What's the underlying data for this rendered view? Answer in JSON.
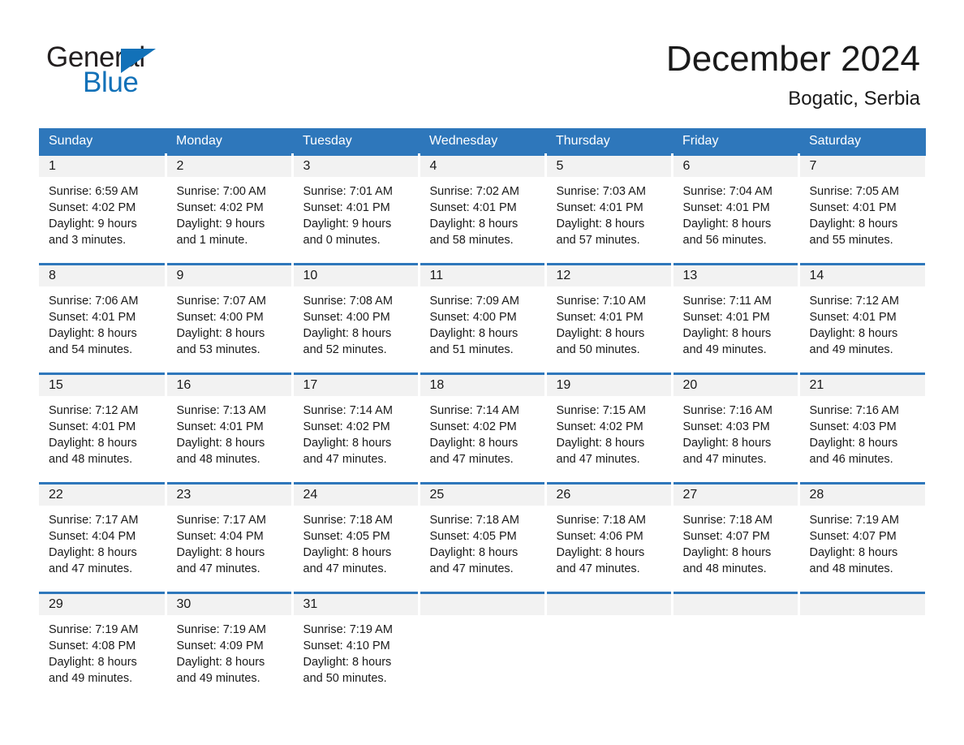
{
  "brand": {
    "word_one": "General",
    "word_two": "Blue",
    "triangle_color": "#1271b8"
  },
  "header": {
    "month_title": "December 2024",
    "location": "Bogatic, Serbia"
  },
  "theme": {
    "header_blue": "#2e77bb",
    "daynum_gray": "#f2f2f2",
    "text": "#1a1a1a"
  },
  "day_headers": [
    "Sunday",
    "Monday",
    "Tuesday",
    "Wednesday",
    "Thursday",
    "Friday",
    "Saturday"
  ],
  "weeks": [
    [
      {
        "day": "1",
        "sunrise": "Sunrise: 6:59 AM",
        "sunset": "Sunset: 4:02 PM",
        "daylight_line1": "Daylight: 9 hours",
        "daylight_line2": "and 3 minutes."
      },
      {
        "day": "2",
        "sunrise": "Sunrise: 7:00 AM",
        "sunset": "Sunset: 4:02 PM",
        "daylight_line1": "Daylight: 9 hours",
        "daylight_line2": "and 1 minute."
      },
      {
        "day": "3",
        "sunrise": "Sunrise: 7:01 AM",
        "sunset": "Sunset: 4:01 PM",
        "daylight_line1": "Daylight: 9 hours",
        "daylight_line2": "and 0 minutes."
      },
      {
        "day": "4",
        "sunrise": "Sunrise: 7:02 AM",
        "sunset": "Sunset: 4:01 PM",
        "daylight_line1": "Daylight: 8 hours",
        "daylight_line2": "and 58 minutes."
      },
      {
        "day": "5",
        "sunrise": "Sunrise: 7:03 AM",
        "sunset": "Sunset: 4:01 PM",
        "daylight_line1": "Daylight: 8 hours",
        "daylight_line2": "and 57 minutes."
      },
      {
        "day": "6",
        "sunrise": "Sunrise: 7:04 AM",
        "sunset": "Sunset: 4:01 PM",
        "daylight_line1": "Daylight: 8 hours",
        "daylight_line2": "and 56 minutes."
      },
      {
        "day": "7",
        "sunrise": "Sunrise: 7:05 AM",
        "sunset": "Sunset: 4:01 PM",
        "daylight_line1": "Daylight: 8 hours",
        "daylight_line2": "and 55 minutes."
      }
    ],
    [
      {
        "day": "8",
        "sunrise": "Sunrise: 7:06 AM",
        "sunset": "Sunset: 4:01 PM",
        "daylight_line1": "Daylight: 8 hours",
        "daylight_line2": "and 54 minutes."
      },
      {
        "day": "9",
        "sunrise": "Sunrise: 7:07 AM",
        "sunset": "Sunset: 4:00 PM",
        "daylight_line1": "Daylight: 8 hours",
        "daylight_line2": "and 53 minutes."
      },
      {
        "day": "10",
        "sunrise": "Sunrise: 7:08 AM",
        "sunset": "Sunset: 4:00 PM",
        "daylight_line1": "Daylight: 8 hours",
        "daylight_line2": "and 52 minutes."
      },
      {
        "day": "11",
        "sunrise": "Sunrise: 7:09 AM",
        "sunset": "Sunset: 4:00 PM",
        "daylight_line1": "Daylight: 8 hours",
        "daylight_line2": "and 51 minutes."
      },
      {
        "day": "12",
        "sunrise": "Sunrise: 7:10 AM",
        "sunset": "Sunset: 4:01 PM",
        "daylight_line1": "Daylight: 8 hours",
        "daylight_line2": "and 50 minutes."
      },
      {
        "day": "13",
        "sunrise": "Sunrise: 7:11 AM",
        "sunset": "Sunset: 4:01 PM",
        "daylight_line1": "Daylight: 8 hours",
        "daylight_line2": "and 49 minutes."
      },
      {
        "day": "14",
        "sunrise": "Sunrise: 7:12 AM",
        "sunset": "Sunset: 4:01 PM",
        "daylight_line1": "Daylight: 8 hours",
        "daylight_line2": "and 49 minutes."
      }
    ],
    [
      {
        "day": "15",
        "sunrise": "Sunrise: 7:12 AM",
        "sunset": "Sunset: 4:01 PM",
        "daylight_line1": "Daylight: 8 hours",
        "daylight_line2": "and 48 minutes."
      },
      {
        "day": "16",
        "sunrise": "Sunrise: 7:13 AM",
        "sunset": "Sunset: 4:01 PM",
        "daylight_line1": "Daylight: 8 hours",
        "daylight_line2": "and 48 minutes."
      },
      {
        "day": "17",
        "sunrise": "Sunrise: 7:14 AM",
        "sunset": "Sunset: 4:02 PM",
        "daylight_line1": "Daylight: 8 hours",
        "daylight_line2": "and 47 minutes."
      },
      {
        "day": "18",
        "sunrise": "Sunrise: 7:14 AM",
        "sunset": "Sunset: 4:02 PM",
        "daylight_line1": "Daylight: 8 hours",
        "daylight_line2": "and 47 minutes."
      },
      {
        "day": "19",
        "sunrise": "Sunrise: 7:15 AM",
        "sunset": "Sunset: 4:02 PM",
        "daylight_line1": "Daylight: 8 hours",
        "daylight_line2": "and 47 minutes."
      },
      {
        "day": "20",
        "sunrise": "Sunrise: 7:16 AM",
        "sunset": "Sunset: 4:03 PM",
        "daylight_line1": "Daylight: 8 hours",
        "daylight_line2": "and 47 minutes."
      },
      {
        "day": "21",
        "sunrise": "Sunrise: 7:16 AM",
        "sunset": "Sunset: 4:03 PM",
        "daylight_line1": "Daylight: 8 hours",
        "daylight_line2": "and 46 minutes."
      }
    ],
    [
      {
        "day": "22",
        "sunrise": "Sunrise: 7:17 AM",
        "sunset": "Sunset: 4:04 PM",
        "daylight_line1": "Daylight: 8 hours",
        "daylight_line2": "and 47 minutes."
      },
      {
        "day": "23",
        "sunrise": "Sunrise: 7:17 AM",
        "sunset": "Sunset: 4:04 PM",
        "daylight_line1": "Daylight: 8 hours",
        "daylight_line2": "and 47 minutes."
      },
      {
        "day": "24",
        "sunrise": "Sunrise: 7:18 AM",
        "sunset": "Sunset: 4:05 PM",
        "daylight_line1": "Daylight: 8 hours",
        "daylight_line2": "and 47 minutes."
      },
      {
        "day": "25",
        "sunrise": "Sunrise: 7:18 AM",
        "sunset": "Sunset: 4:05 PM",
        "daylight_line1": "Daylight: 8 hours",
        "daylight_line2": "and 47 minutes."
      },
      {
        "day": "26",
        "sunrise": "Sunrise: 7:18 AM",
        "sunset": "Sunset: 4:06 PM",
        "daylight_line1": "Daylight: 8 hours",
        "daylight_line2": "and 47 minutes."
      },
      {
        "day": "27",
        "sunrise": "Sunrise: 7:18 AM",
        "sunset": "Sunset: 4:07 PM",
        "daylight_line1": "Daylight: 8 hours",
        "daylight_line2": "and 48 minutes."
      },
      {
        "day": "28",
        "sunrise": "Sunrise: 7:19 AM",
        "sunset": "Sunset: 4:07 PM",
        "daylight_line1": "Daylight: 8 hours",
        "daylight_line2": "and 48 minutes."
      }
    ],
    [
      {
        "day": "29",
        "sunrise": "Sunrise: 7:19 AM",
        "sunset": "Sunset: 4:08 PM",
        "daylight_line1": "Daylight: 8 hours",
        "daylight_line2": "and 49 minutes."
      },
      {
        "day": "30",
        "sunrise": "Sunrise: 7:19 AM",
        "sunset": "Sunset: 4:09 PM",
        "daylight_line1": "Daylight: 8 hours",
        "daylight_line2": "and 49 minutes."
      },
      {
        "day": "31",
        "sunrise": "Sunrise: 7:19 AM",
        "sunset": "Sunset: 4:10 PM",
        "daylight_line1": "Daylight: 8 hours",
        "daylight_line2": "and 50 minutes."
      },
      {
        "day": "",
        "sunrise": "",
        "sunset": "",
        "daylight_line1": "",
        "daylight_line2": ""
      },
      {
        "day": "",
        "sunrise": "",
        "sunset": "",
        "daylight_line1": "",
        "daylight_line2": ""
      },
      {
        "day": "",
        "sunrise": "",
        "sunset": "",
        "daylight_line1": "",
        "daylight_line2": ""
      },
      {
        "day": "",
        "sunrise": "",
        "sunset": "",
        "daylight_line1": "",
        "daylight_line2": ""
      }
    ]
  ]
}
